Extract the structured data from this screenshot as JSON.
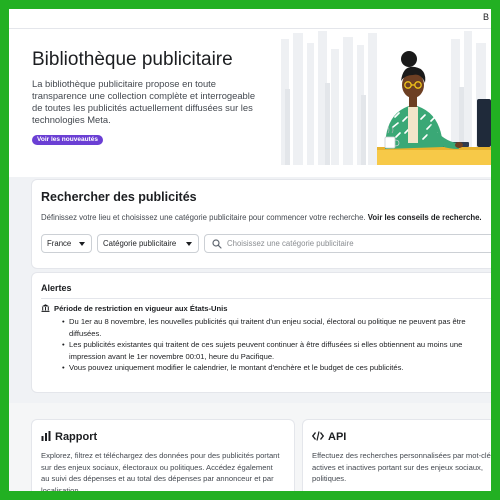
{
  "topbar": {
    "right_text": "B"
  },
  "hero": {
    "title": "Bibliothèque publicitaire",
    "description": "La bibliothèque publicitaire propose en toute transparence une collection complète et interrogeable de toutes les publicités actuellement diffusées sur les technologies Meta.",
    "pill": "Voir les nouveautés"
  },
  "search": {
    "title": "Rechercher des publicités",
    "hint": "Définissez votre lieu et choisissez une catégorie publicitaire pour commencer votre recherche.",
    "hint_link": "Voir les conseils de recherche.",
    "country": "France",
    "category": "Catégorie publicitaire",
    "placeholder": "Choisissez une catégorie publicitaire"
  },
  "alerts": {
    "title": "Alertes",
    "heading": "Période de restriction en vigueur aux États-Unis",
    "items": [
      "Du 1er au 8 novembre, les nouvelles publicités qui traitent d'un enjeu social, électoral ou politique ne peuvent pas être diffusées.",
      "Les publicités existantes qui traitent de ces sujets peuvent continuer à être diffusées si elles obtiennent au moins une impression avant le 1er novembre 00:01, heure du Pacifique.",
      "Vous pouvez uniquement modifier le calendrier, le montant d'enchère et le budget de ces publicités."
    ]
  },
  "features": {
    "report": {
      "title": "Rapport",
      "description": "Explorez, filtrez et téléchargez des données pour des publicités portant sur des enjeux sociaux, électoraux ou politiques. Accédez également au suivi des dépenses et au total des dépenses par annonceur et par localisation."
    },
    "api": {
      "title": "API",
      "description": "Effectuez des recherches personnalisées par mot-clé actives et inactives portant sur des enjeux sociaux, politiques."
    }
  },
  "colors": {
    "frame_border": "#22b022",
    "pill": "#6b3fd4"
  }
}
